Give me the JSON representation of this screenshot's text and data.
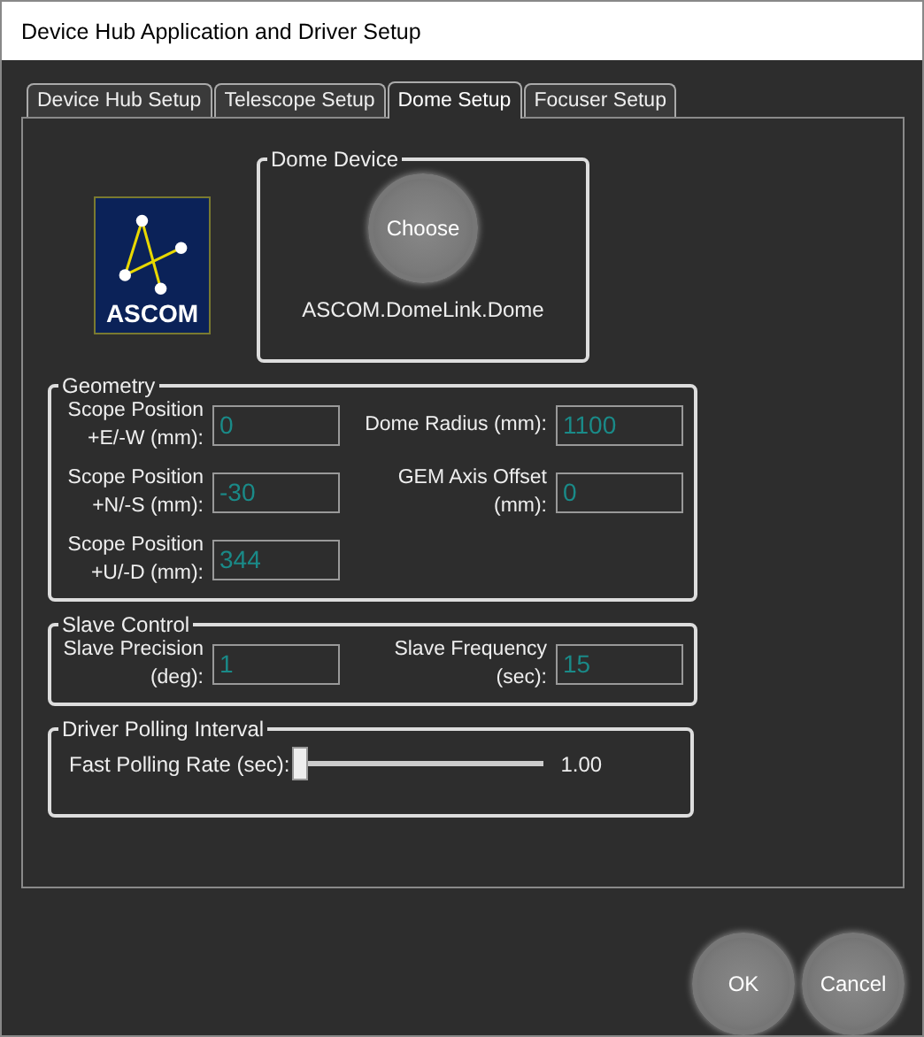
{
  "window": {
    "title": "Device Hub Application and Driver Setup"
  },
  "tabs": [
    {
      "label": "Device Hub Setup",
      "selected": false
    },
    {
      "label": "Telescope Setup",
      "selected": false
    },
    {
      "label": "Dome Setup",
      "selected": true
    },
    {
      "label": "Focuser Setup",
      "selected": false
    }
  ],
  "logo": {
    "text": "ASCOM"
  },
  "dome_device": {
    "title": "Dome Device",
    "button": "Choose",
    "device": "ASCOM.DomeLink.Dome"
  },
  "geometry": {
    "title": "Geometry",
    "fields": [
      {
        "label": "Scope Position +E/-W (mm):",
        "value": "0"
      },
      {
        "label": "Dome Radius (mm):",
        "value": "1100"
      },
      {
        "label": "Scope Position +N/-S (mm):",
        "value": "-30"
      },
      {
        "label": "GEM Axis Offset (mm):",
        "value": "0"
      },
      {
        "label": "Scope Position +U/-D (mm):",
        "value": "344"
      }
    ]
  },
  "slave_control": {
    "title": "Slave Control",
    "fields": [
      {
        "label": "Slave Precision (deg):",
        "value": "1"
      },
      {
        "label": "Slave Frequency (sec):",
        "value": "15"
      }
    ]
  },
  "polling": {
    "title": "Driver Polling Interval",
    "label": "Fast Polling Rate (sec):",
    "level": 0,
    "reading": "1.00"
  },
  "buttons": [
    "OK",
    "Cancel"
  ]
}
